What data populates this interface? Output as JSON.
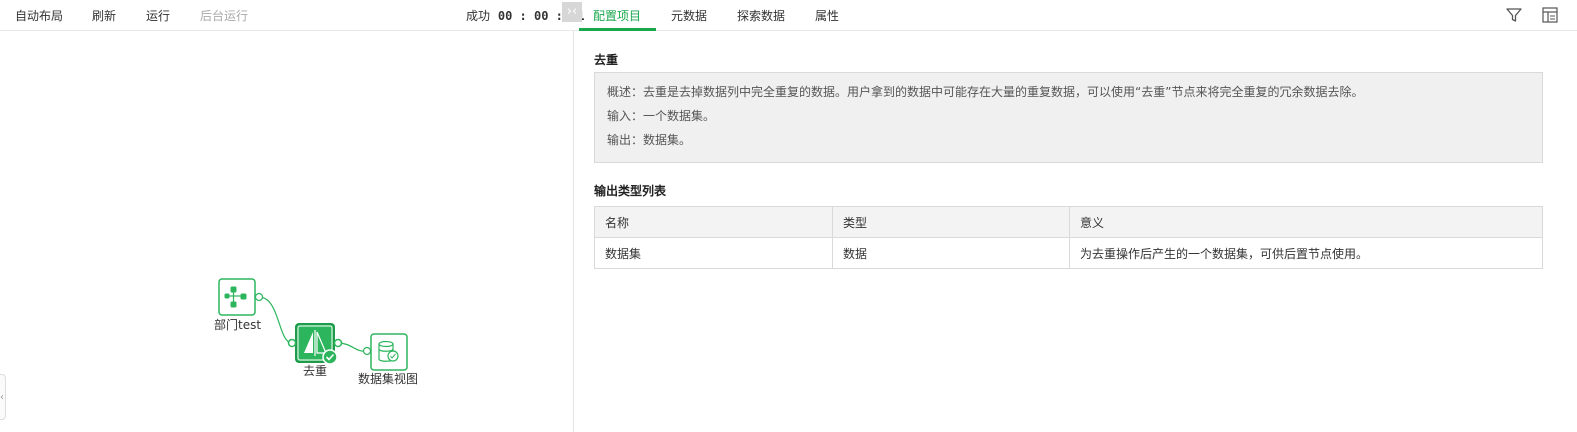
{
  "toolbar": {
    "auto_layout": "自动布局",
    "refresh": "刷新",
    "run": "运行",
    "background_run": "后台运行",
    "status_label": "成功",
    "status_time": "00 : 00 : 01"
  },
  "tabs": [
    {
      "label": "配置项目",
      "active": true
    },
    {
      "label": "元数据",
      "active": false
    },
    {
      "label": "探索数据",
      "active": false
    },
    {
      "label": "属性",
      "active": false
    }
  ],
  "tools": {
    "filter_icon": "filter-icon",
    "layout_icon": "layout-settings-icon"
  },
  "colors": {
    "accent": "#1aa84e",
    "node_border": "#2db55d"
  },
  "flow": {
    "nodes": [
      {
        "label": "部门test",
        "icon": "hierarchy-icon"
      },
      {
        "label": "去重",
        "icon": "dedup-icon",
        "status": "success"
      },
      {
        "label": "数据集视图",
        "icon": "database-view-icon"
      }
    ]
  },
  "config": {
    "title": "去重",
    "description": "概述：去重是去掉数据列中完全重复的数据。用户拿到的数据中可能存在大量的重复数据，可以使用“去重”节点来将完全重复的冗余数据去除。",
    "input": "输入：一个数据集。",
    "output": "输出：数据集。",
    "output_types_title": "输出类型列表",
    "table": {
      "headers": [
        "名称",
        "类型",
        "意义"
      ],
      "rows": [
        [
          "数据集",
          "数据",
          "为去重操作后产生的一个数据集，可供后置节点使用。"
        ]
      ]
    }
  }
}
